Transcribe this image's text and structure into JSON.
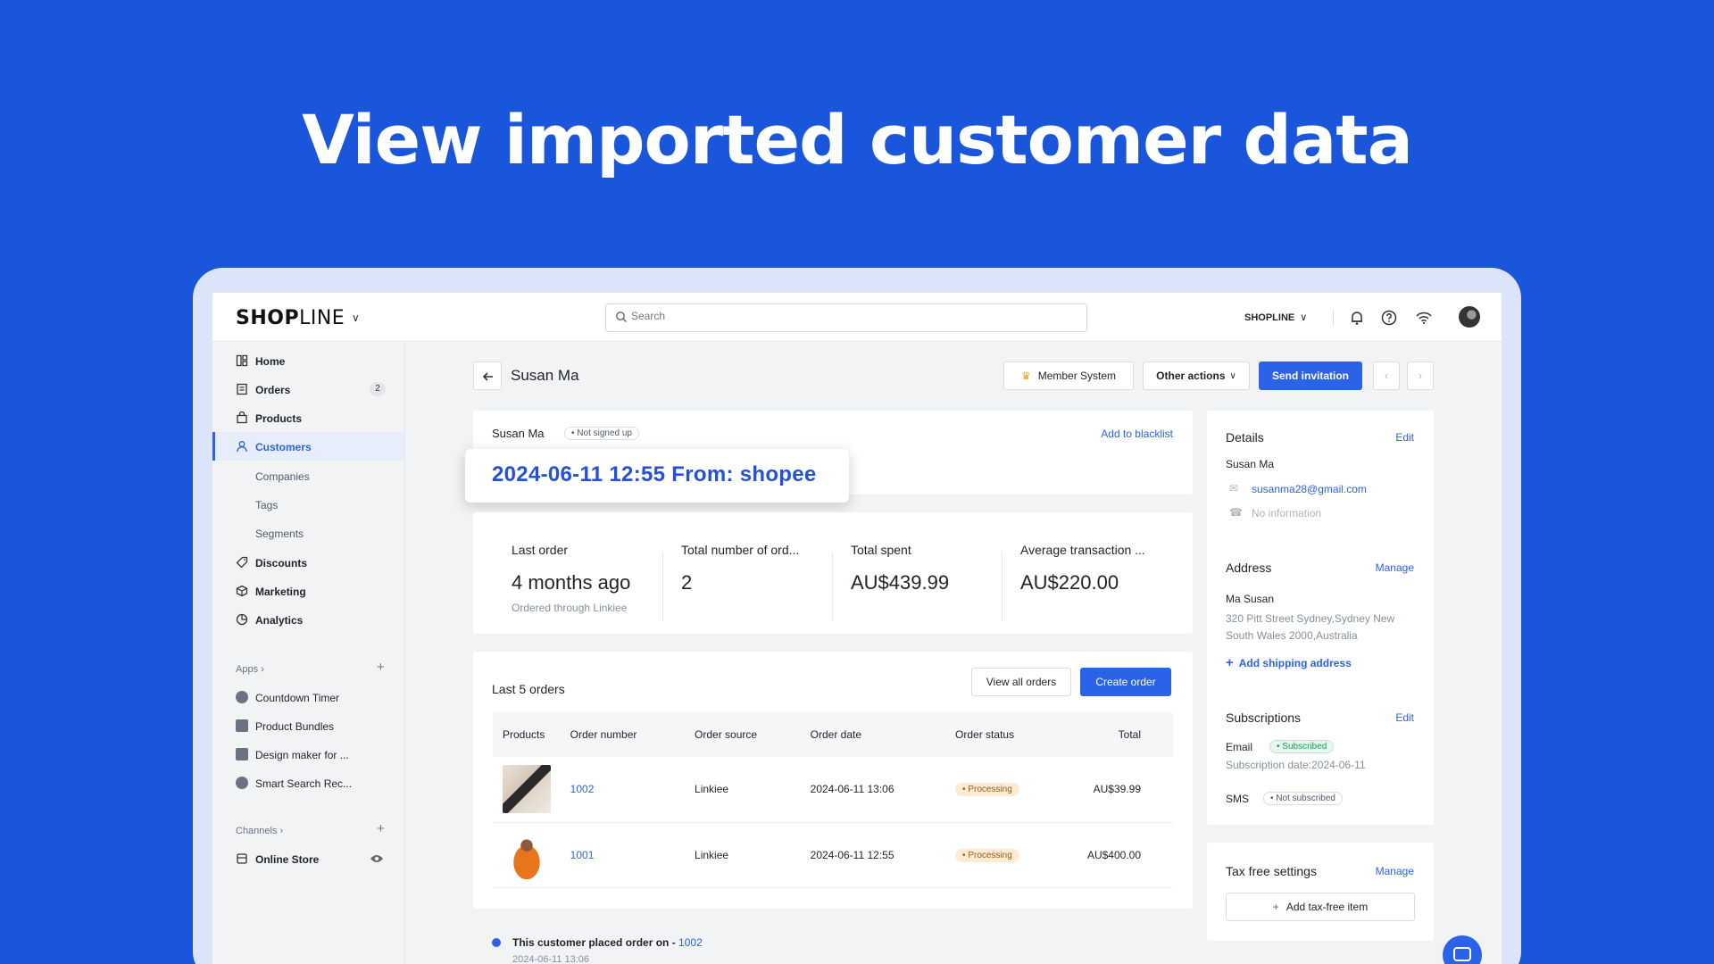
{
  "headline": "View imported customer data",
  "topbar": {
    "logo_bold": "SHOP",
    "logo_thin": "LINE",
    "search_placeholder": "Search",
    "store_name": "SHOPLINE"
  },
  "sidebar": {
    "items": [
      {
        "label": "Home"
      },
      {
        "label": "Orders",
        "badge": "2"
      },
      {
        "label": "Products"
      },
      {
        "label": "Customers"
      },
      {
        "label": "Discounts"
      },
      {
        "label": "Marketing"
      },
      {
        "label": "Analytics"
      }
    ],
    "customer_subs": [
      "Companies",
      "Tags",
      "Segments"
    ],
    "apps_heading": "Apps",
    "apps": [
      "Countdown Timer",
      "Product Bundles",
      "Design maker for ...",
      "Smart Search Rec..."
    ],
    "channels_heading": "Channels",
    "channels": [
      "Online Store"
    ]
  },
  "header": {
    "title": "Susan Ma",
    "member_system": "Member System",
    "other_actions": "Other actions",
    "send_invitation": "Send invitation"
  },
  "profile": {
    "name": "Susan Ma",
    "status": "Not signed up",
    "blacklist": "Add to blacklist",
    "tooltip": "2024-06-11 12:55  From: shopee"
  },
  "stats": [
    {
      "label": "Last order",
      "value": "4 months ago",
      "sub": "Ordered through Linkiee"
    },
    {
      "label": "Total number of ord...",
      "value": "2"
    },
    {
      "label": "Total spent",
      "value": "AU$439.99"
    },
    {
      "label": "Average transaction ...",
      "value": "AU$220.00"
    }
  ],
  "orders": {
    "title": "Last 5 orders",
    "view_all": "View all orders",
    "create": "Create order",
    "columns": [
      "Products",
      "Order number",
      "Order source",
      "Order date",
      "Order status",
      "Total"
    ],
    "rows": [
      {
        "number": "1002",
        "source": "Linkiee",
        "date": "2024-06-11 13:06",
        "status": "Processing",
        "total": "AU$39.99"
      },
      {
        "number": "1001",
        "source": "Linkiee",
        "date": "2024-06-11 12:55",
        "status": "Processing",
        "total": "AU$400.00"
      }
    ]
  },
  "timeline": {
    "text": "This customer placed order on -",
    "order": "1002",
    "time": "2024-06-11 13:06"
  },
  "details": {
    "title": "Details",
    "edit": "Edit",
    "name": "Susan Ma",
    "email": "susanma28@gmail.com",
    "phone": "No information",
    "address_title": "Address",
    "manage": "Manage",
    "address_name": "Ma Susan",
    "address_line1": "320 Pitt Street Sydney,Sydney New",
    "address_line2": "South Wales 2000,Australia",
    "add_shipping": "Add shipping address",
    "subs_title": "Subscriptions",
    "subs_edit": "Edit",
    "email_label": "Email",
    "email_status": "Subscribed",
    "subs_date": "Subscription date:2024-06-11",
    "sms_label": "SMS",
    "sms_status": "Not subscribed"
  },
  "tax": {
    "title": "Tax free settings",
    "manage": "Manage",
    "add": "Add tax-free item"
  },
  "colors": {
    "brand_blue": "#1a56db",
    "primary": "#2a62e8"
  }
}
